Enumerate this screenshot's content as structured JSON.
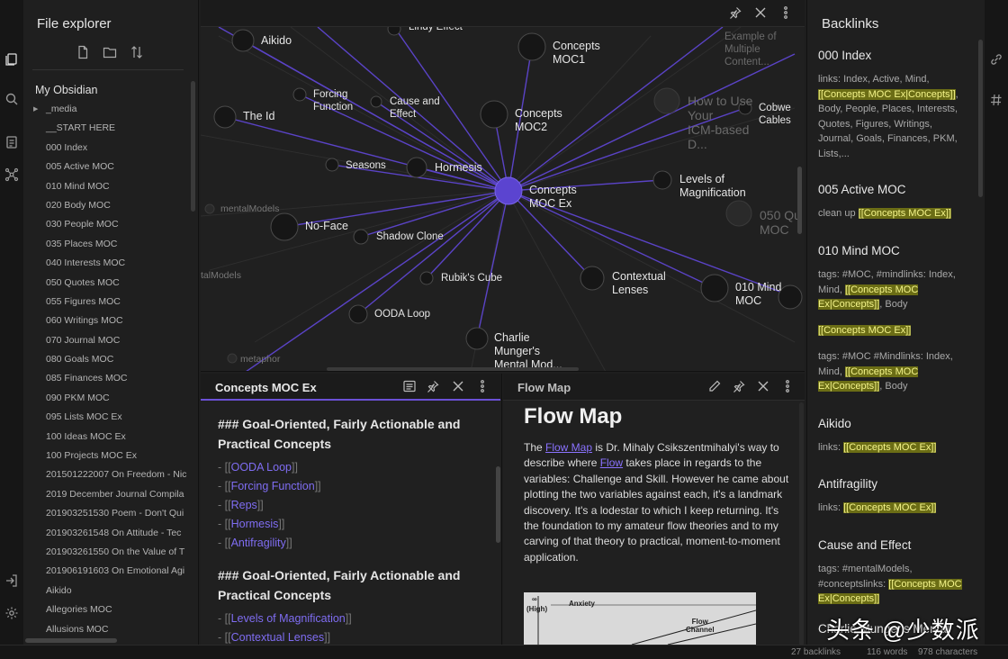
{
  "file_explorer": {
    "title": "File explorer",
    "vault_name": "My Obsidian",
    "items": [
      "_media",
      "__START HERE",
      "000 Index",
      "005 Active MOC",
      "010 Mind MOC",
      "020 Body MOC",
      "030 People MOC",
      "035 Places MOC",
      "040 Interests MOC",
      "050 Quotes MOC",
      "055 Figures MOC",
      "060 Writings MOC",
      "070 Journal MOC",
      "080 Goals MOC",
      "085 Finances MOC",
      "090 PKM MOC",
      "095 Lists MOC Ex",
      "100 Ideas MOC Ex",
      "100 Projects MOC Ex",
      "201501222007 On Freedom - Nic",
      "2019 December Journal Compila",
      "201903251530 Poem - Don't Qui",
      "201903261548 On Attitude - Tec",
      "201903261550 On the Value of T",
      "201906191603 On Emotional Agi",
      "Aikido",
      "Allegories MOC",
      "Allusions MOC"
    ]
  },
  "graph": {
    "nodes": {
      "aikido": "Aikido",
      "lindy": "Lindy Effect",
      "concepts_moc1": "Concepts\nMOC1",
      "example": "Example of\nMultiple\nContent...",
      "forcing": "Forcing\nFunction",
      "cause": "Cause and\nEffect",
      "the_id": "The Id",
      "concepts_moc2": "Concepts\nMOC2",
      "how_to_use": "How to Use\nYour\nICM-based\nD...",
      "cobweb": "Cobwe\nCables",
      "seasons": "Seasons",
      "hormesis": "Hormesis",
      "concepts_moc_ex": "Concepts\nMOC Ex",
      "levels": "Levels of\nMagnification",
      "mental_models": "mentalModels",
      "no_face": "No-Face",
      "shadow_clone": "Shadow Clone",
      "q050": "050 Qu\nMOC",
      "tal_models": "talModels",
      "rubik": "Rubik's Cube",
      "contextual": "Contextual\nLenses",
      "mind010": "010 Mind\nMOC",
      "ooda": "OODA Loop",
      "charlie": "Charlie\nMunger's\nMental Mod...",
      "metaphor": "metaphor"
    }
  },
  "editor": {
    "title": "Concepts MOC Ex",
    "heading1": "### Goal-Oriented, Fairly Actionable and Practical Concepts",
    "links1": [
      "OODA Loop",
      "Forcing Function",
      "Reps",
      "Hormesis",
      "Antifragility"
    ],
    "heading2": "### Goal-Oriented, Fairly Actionable and Practical Concepts",
    "links2": [
      "Levels of Magnification",
      "Contextual Lenses"
    ]
  },
  "preview": {
    "title": "Flow Map",
    "h1": "Flow Map",
    "p_the": "The ",
    "p_link1": "Flow Map",
    "p_mid": " is Dr. Mihaly Csikszentmihalyi's way to describe where ",
    "p_link2": "Flow",
    "p_rest": " takes place in regards to the variables: Challenge and Skill. However he came about plotting the two variables against each, it's a landmark discovery. It's a lodestar to which I keep returning. It's the foundation to my amateur flow theories and to my carving of that theory to practical, moment-to-moment application.",
    "img_inf": "∞",
    "img_high": "(High)",
    "img_anxiety": "Anxiety",
    "img_flow": "Flow\nChannel"
  },
  "backlinks": {
    "title": "Backlinks",
    "entries": [
      {
        "name": "000 Index",
        "pre": "links: Index, Active, Mind, ",
        "hl": "[[Concepts MOC Ex|Concepts]]",
        "post": ", Body, People, Places, Interests, Quotes, Figures, Writings, Journal, Goals, Finances, PKM, Lists,..."
      },
      {
        "name": "005 Active MOC",
        "pre": "clean up ",
        "hl": "[[Concepts MOC Ex]]",
        "post": ""
      },
      {
        "name": "010 Mind MOC",
        "pre": "tags: #MOC, #mindlinks: Index, Mind, ",
        "hl": "[[Concepts MOC Ex|Concepts]]",
        "post": ", Body"
      },
      {
        "name": "",
        "pre": "",
        "hl": "[[Concepts MOC Ex]]",
        "post": ""
      },
      {
        "name": "",
        "pre": "tags: #MOC #Mindlinks: Index, Mind, ",
        "hl": "[[Concepts MOC Ex|Concepts]]",
        "post": ", Body"
      },
      {
        "name": "Aikido",
        "pre": "links: ",
        "hl": "[[Concepts MOC Ex]]",
        "post": ""
      },
      {
        "name": "Antifragility",
        "pre": "links: ",
        "hl": "[[Concepts MOC Ex]]",
        "post": ""
      },
      {
        "name": "Cause and Effect",
        "pre": "tags: #mentalModels, #conceptslinks: ",
        "hl": "[[Concepts MOC Ex|Concepts]]",
        "post": ""
      },
      {
        "name": "Charlie Munger's Mental",
        "pre": "",
        "hl": "",
        "post": ""
      }
    ]
  },
  "status": {
    "backlinks": "27 backlinks",
    "words": "116 words",
    "characters": "978 characters"
  },
  "watermark": "头条 @少数派",
  "colors": {
    "accent": "#6b50d6",
    "link": "#7f6df2",
    "highlight_bg": "#6b6d15",
    "highlight_fg": "#f4f48a"
  }
}
